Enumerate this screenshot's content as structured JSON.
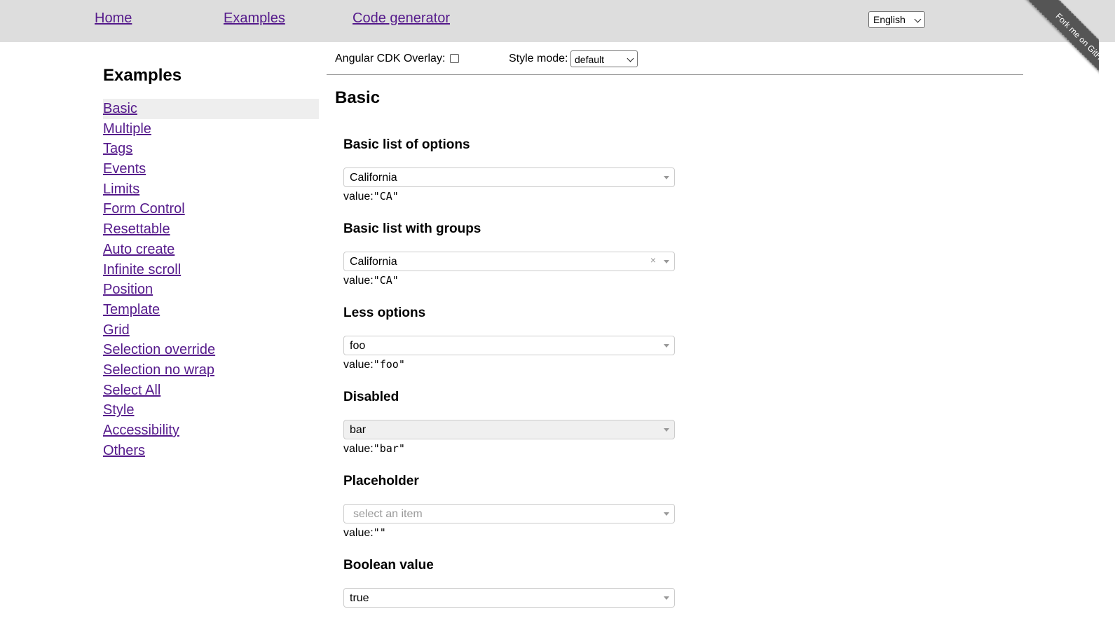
{
  "nav": {
    "home": "Home",
    "examples": "Examples",
    "code_generator": "Code generator",
    "language": "English",
    "fork_ribbon": "Fork me on GitHub"
  },
  "sidebar": {
    "title": "Examples",
    "items": [
      {
        "label": "Basic",
        "active": true
      },
      {
        "label": "Multiple"
      },
      {
        "label": "Tags"
      },
      {
        "label": "Events"
      },
      {
        "label": "Limits"
      },
      {
        "label": "Form Control"
      },
      {
        "label": "Resettable"
      },
      {
        "label": "Auto create"
      },
      {
        "label": "Infinite scroll"
      },
      {
        "label": "Position"
      },
      {
        "label": "Template"
      },
      {
        "label": "Grid"
      },
      {
        "label": "Selection override"
      },
      {
        "label": "Selection no wrap"
      },
      {
        "label": "Select All"
      },
      {
        "label": "Style"
      },
      {
        "label": "Accessibility"
      },
      {
        "label": "Others"
      }
    ]
  },
  "options": {
    "overlay_label": "Angular CDK Overlay:",
    "overlay_checked": false,
    "style_mode_label": "Style mode:",
    "style_mode_value": "default"
  },
  "main": {
    "title": "Basic",
    "value_prefix": "value:",
    "sections": [
      {
        "heading": "Basic list of options",
        "selected": "California",
        "value": "\"CA\""
      },
      {
        "heading": "Basic list with groups",
        "selected": "California",
        "value": "\"CA\"",
        "clear_glyph": "×"
      },
      {
        "heading": "Less options",
        "selected": "foo",
        "value": "\"foo\""
      },
      {
        "heading": "Disabled",
        "selected": "bar",
        "value": "\"bar\""
      },
      {
        "heading": "Placeholder",
        "placeholder": "select an item",
        "value": "\"\""
      },
      {
        "heading": "Boolean value",
        "selected": "true"
      }
    ]
  },
  "colors": {
    "topbar_bg": "#dddddd",
    "link": "#551a8b",
    "ribbon": "#555555",
    "active_item_bg": "#eeeeee"
  }
}
